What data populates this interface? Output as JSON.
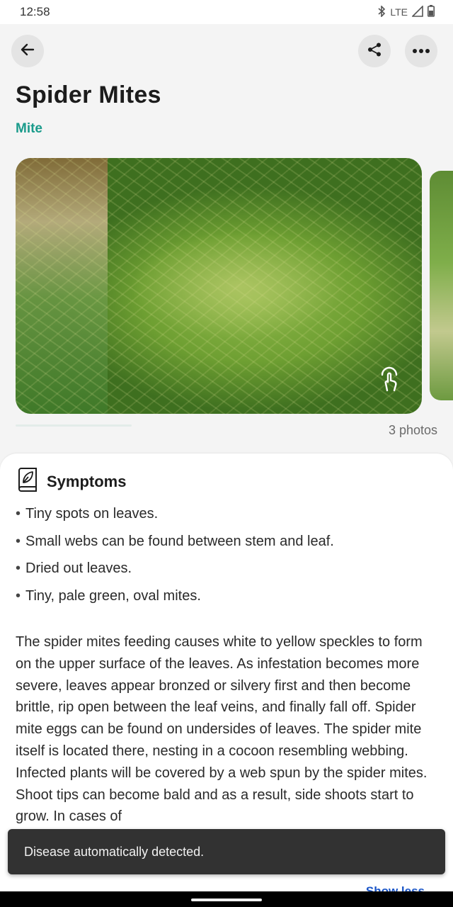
{
  "status_bar": {
    "time": "12:58",
    "network": "LTE",
    "icons": [
      "bluetooth-icon",
      "signal-icon",
      "battery-icon"
    ]
  },
  "top_bar": {
    "icons": [
      "back-arrow-icon",
      "share-icon",
      "more-options-icon"
    ]
  },
  "header": {
    "title": "Spider Mites",
    "category": "Mite"
  },
  "gallery": {
    "photos_count_label": "3 photos",
    "overlay_icon": "tap-hand-icon"
  },
  "symptoms": {
    "heading": "Symptoms",
    "icon": "book-leaf-icon",
    "bullets": [
      "Tiny spots on leaves.",
      "Small webs can be found between stem and leaf.",
      "Dried out leaves.",
      "Tiny, pale green, oval mites."
    ],
    "description": "The spider mites feeding causes white to yellow speckles to form on the upper surface of the leaves. As infestation becomes more severe, leaves appear bronzed or silvery first and then become brittle, rip open between the leaf veins, and finally fall off. Spider mite eggs can be found on undersides of leaves. The spider mite itself is located there, nesting in a cocoon resembling webbing. Infected plants will be covered by a web spun by the spider mites. Shoot tips can become bald and as  a result, side shoots start to grow. In cases of",
    "show_less_label": "Show less"
  },
  "snackbar": {
    "message": "Disease automatically detected."
  },
  "colors": {
    "accent": "#1a9b8b",
    "link": "#1b56c8",
    "snackbar_bg": "#323232"
  }
}
